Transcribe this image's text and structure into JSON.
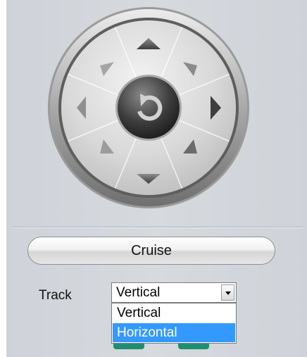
{
  "ptz": {
    "controls": [
      "up",
      "down",
      "left",
      "right",
      "up-left",
      "up-right",
      "down-left",
      "down-right",
      "reset"
    ]
  },
  "cruise": {
    "label": "Cruise"
  },
  "track": {
    "label": "Track",
    "selected": "Vertical",
    "options": [
      "Vertical",
      "Horizontal"
    ],
    "highlighted": "Horizontal"
  },
  "colors": {
    "panel": "#d3d6db",
    "highlight": "#3399ff",
    "teal_buttons": "#1e8f71"
  }
}
